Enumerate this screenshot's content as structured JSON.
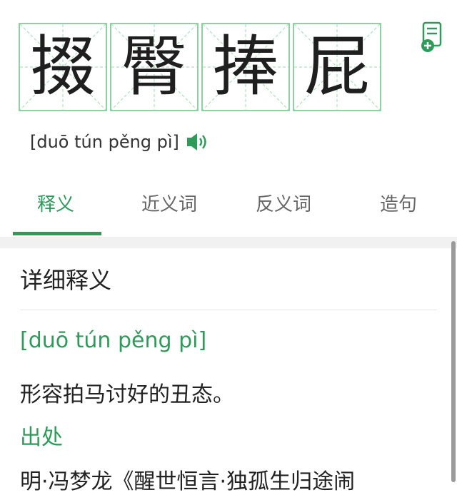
{
  "idiom": {
    "characters": [
      "掇",
      "臀",
      "捧",
      "屁"
    ],
    "pinyin": "[duō tún pěng pì]"
  },
  "tabs": [
    {
      "label": "释义",
      "active": true
    },
    {
      "label": "近义词",
      "active": false
    },
    {
      "label": "反义词",
      "active": false
    },
    {
      "label": "造句",
      "active": false
    }
  ],
  "detail": {
    "title": "详细释义",
    "pinyin": "[duō tún pěng pì]",
    "definition": "形容拍马讨好的丑态。",
    "source_label": "出处",
    "source_text": "明·冯梦龙《醒世恒言·独孤生归途闹"
  },
  "icons": {
    "save": "notebook-add-icon",
    "speaker": "speaker-icon"
  },
  "colors": {
    "accent": "#2f9b5b",
    "grid": "#8fd1a3"
  }
}
